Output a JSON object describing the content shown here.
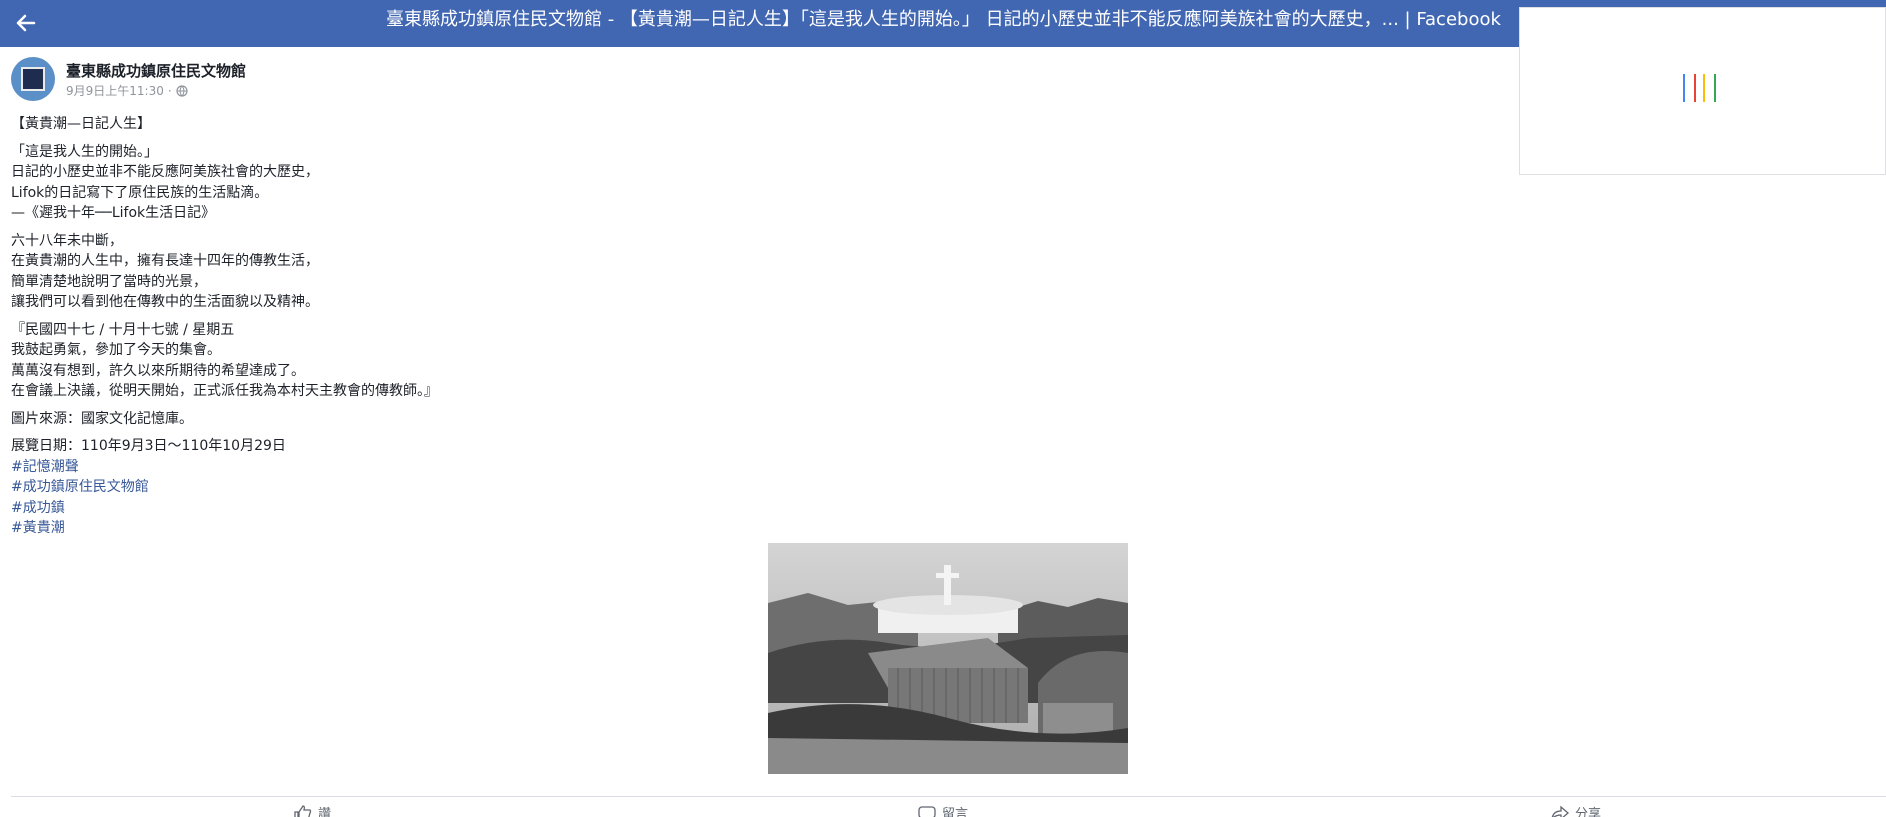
{
  "header": {
    "title": "臺東縣成功鎮原住民文物館 - 【黃貴潮—日記人生】「這是我人生的開始。」 日記的小歷史並非不能反應阿美族社會的大歷史，... | Facebook",
    "back_icon": "back-arrow-icon",
    "background": "#4267b2"
  },
  "loader": {
    "bar_colors": [
      "#4285f4",
      "#ea4335",
      "#fbbc05",
      "#34a853"
    ]
  },
  "post": {
    "page_name": "臺東縣成功鎮原住民文物館",
    "timestamp": "9月9日上午11:30",
    "separator": "·",
    "privacy_icon": "globe-icon",
    "paragraphs": [
      [
        "【黃貴潮—日記人生】"
      ],
      [
        "「這是我人生的開始。」",
        "日記的小歷史並非不能反應阿美族社會的大歷史，",
        "Lifok的日記寫下了原住民族的生活點滴。",
        "—《遲我十年──Lifok生活日記》"
      ],
      [
        "六十八年未中斷，",
        "在黃貴潮的人生中，擁有長達十四年的傳教生活，",
        "簡單清楚地說明了當時的光景，",
        "讓我們可以看到他在傳教中的生活面貌以及精神。"
      ],
      [
        "『民國四十七 / 十月十七號 / 星期五",
        "我鼓起勇氣，參加了今天的集會。",
        "萬萬沒有想到，許久以來所期待的希望達成了。",
        "在會議上決議，從明天開始，正式派任我為本村天主教會的傳教師。』"
      ],
      [
        "圖片來源：國家文化記憶庫。"
      ],
      [
        "展覽日期：110年9月3日～110年10月29日"
      ]
    ],
    "hashtags": [
      "#記憶潮聲",
      "#成功鎮原住民文物館",
      "#成功鎮",
      "#黃貴潮"
    ],
    "hashtag_color": "#385898",
    "photo_icon": "photo-church-village"
  },
  "actions": [
    {
      "label": "讚",
      "icon": "like-icon"
    },
    {
      "label": "留言",
      "icon": "comment-icon"
    },
    {
      "label": "分享",
      "icon": "share-icon"
    }
  ]
}
